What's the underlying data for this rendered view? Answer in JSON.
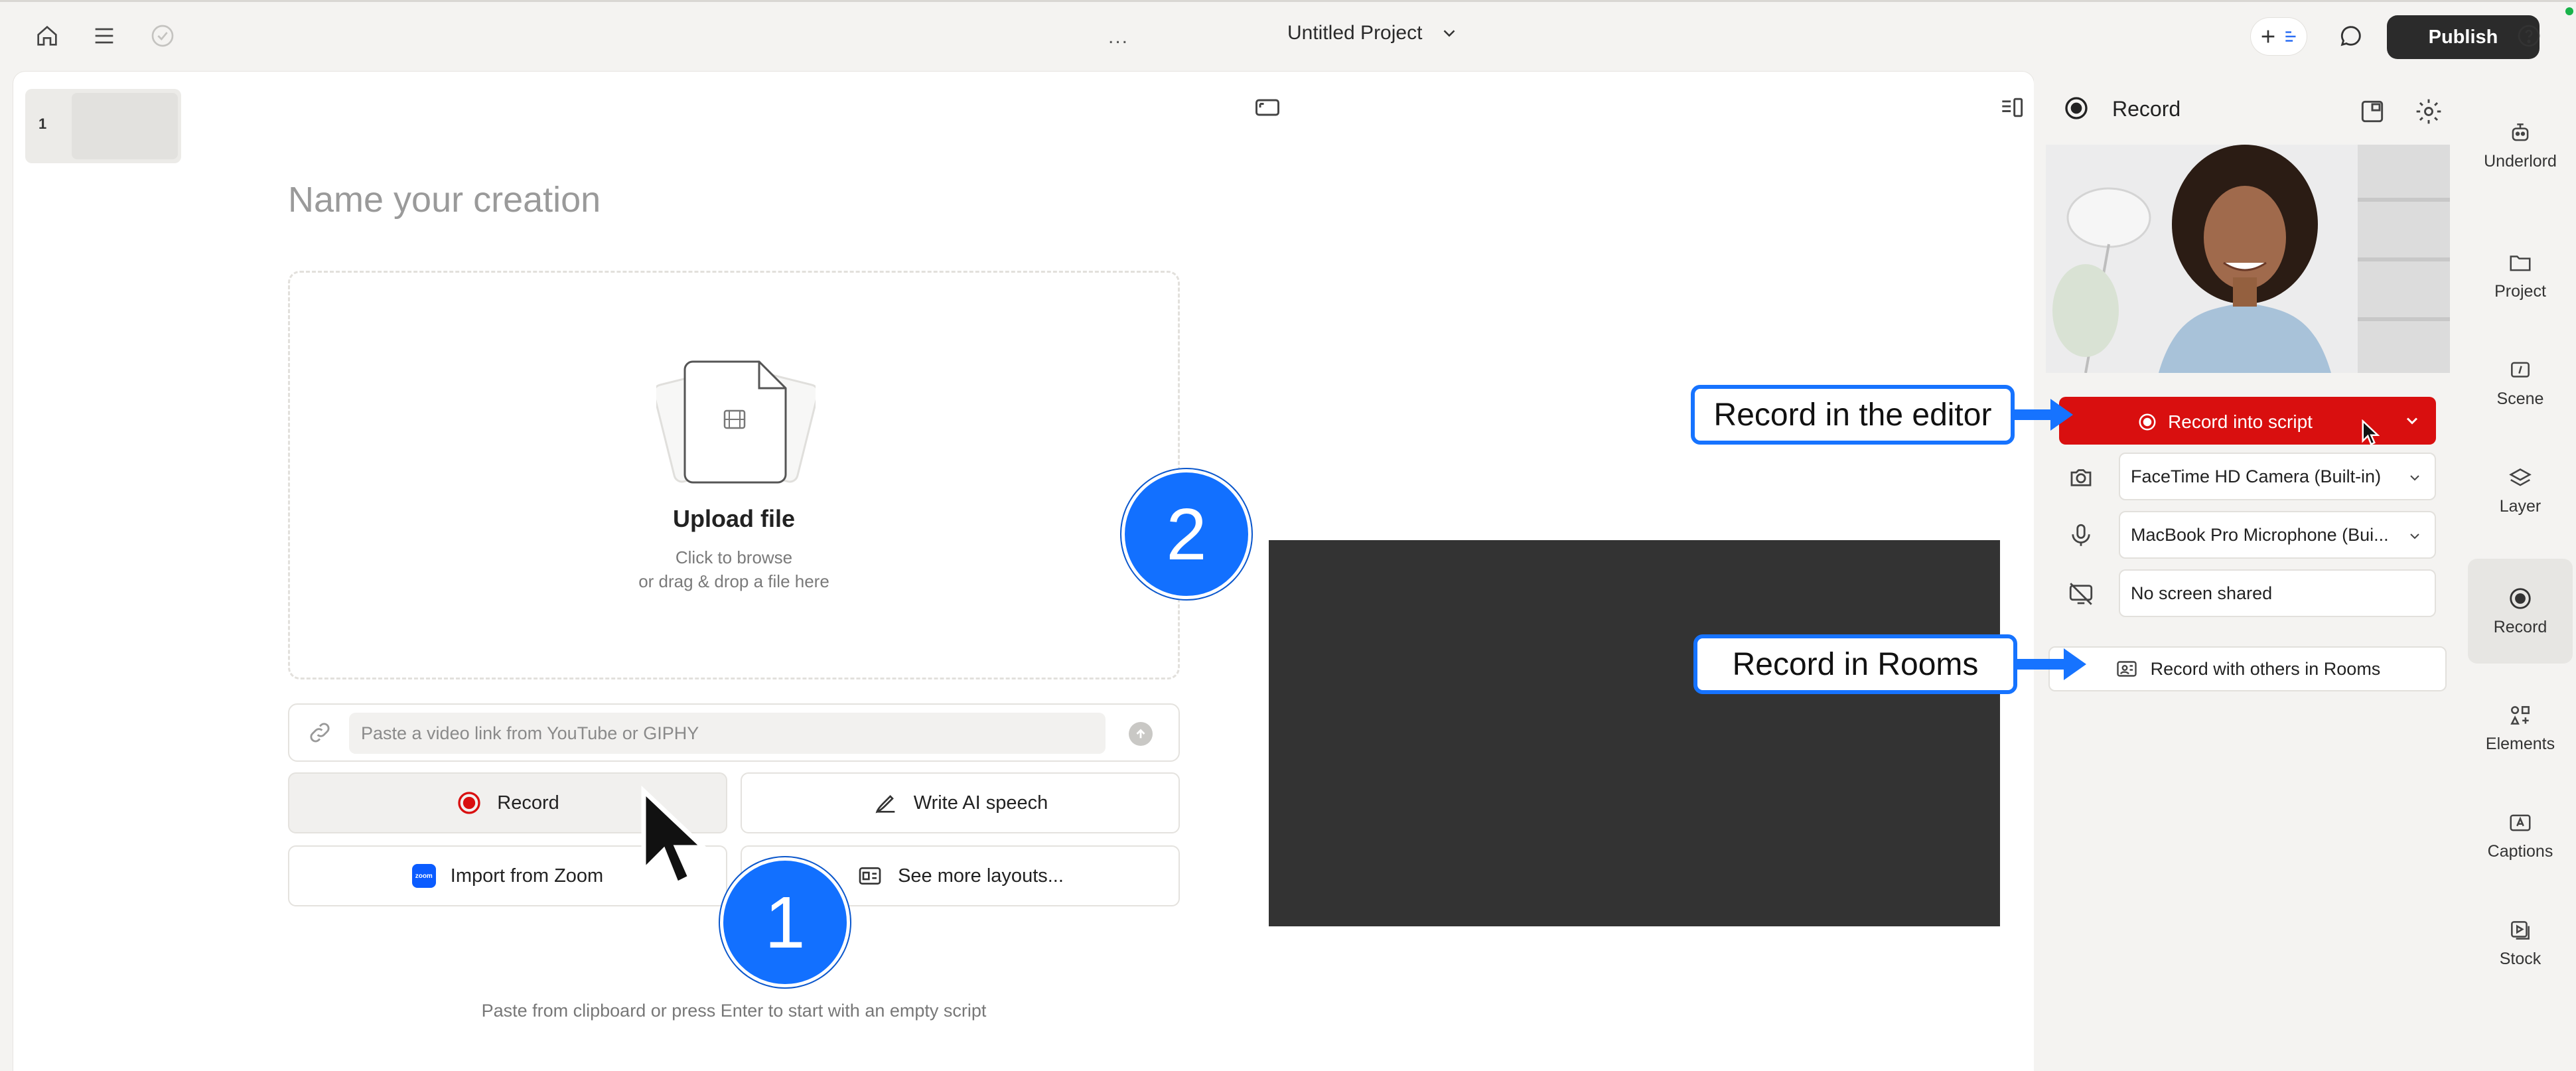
{
  "topbar": {
    "breadcrumb_stub": "...",
    "project_title": "Untitled Project",
    "publish_label": "Publish"
  },
  "canvas": {
    "scene_number": "1",
    "name_placeholder": "Name your creation",
    "upload": {
      "title": "Upload file",
      "line1": "Click to browse",
      "line2": "or drag & drop a file here"
    },
    "link_placeholder": "Paste a video link from YouTube or GIPHY",
    "options": {
      "record": "Record",
      "write_ai": "Write AI speech",
      "import_zoom": "Import from Zoom",
      "zoom_logo": "zoom",
      "more_layouts": "See more layouts..."
    },
    "paste_hint": "Paste from clipboard or press Enter to start with an empty script"
  },
  "record_panel": {
    "title": "Record",
    "record_into_script": "Record into script",
    "camera": "FaceTime HD Camera (Built-in)",
    "microphone": "MacBook Pro Microphone (Bui...",
    "screen": "No screen shared",
    "rooms": "Record with others in Rooms"
  },
  "sidebar": {
    "items": [
      {
        "label": "Underlord",
        "icon": "robot-icon"
      },
      {
        "label": "Project",
        "icon": "folder-icon"
      },
      {
        "label": "Scene",
        "icon": "scene-icon"
      },
      {
        "label": "Layer",
        "icon": "layers-icon"
      },
      {
        "label": "Record",
        "icon": "record-icon"
      },
      {
        "label": "Elements",
        "icon": "elements-icon"
      },
      {
        "label": "Captions",
        "icon": "captions-icon"
      },
      {
        "label": "Stock",
        "icon": "stock-icon"
      }
    ]
  },
  "annotations": {
    "callout_editor": "Record in the editor",
    "callout_rooms": "Record in Rooms",
    "step1": "1",
    "step2": "2"
  },
  "colors": {
    "record_red": "#d90f0f",
    "annotation_blue": "#1673ff",
    "publish_bg": "#2b2b2b",
    "preview_bg": "#333333"
  }
}
